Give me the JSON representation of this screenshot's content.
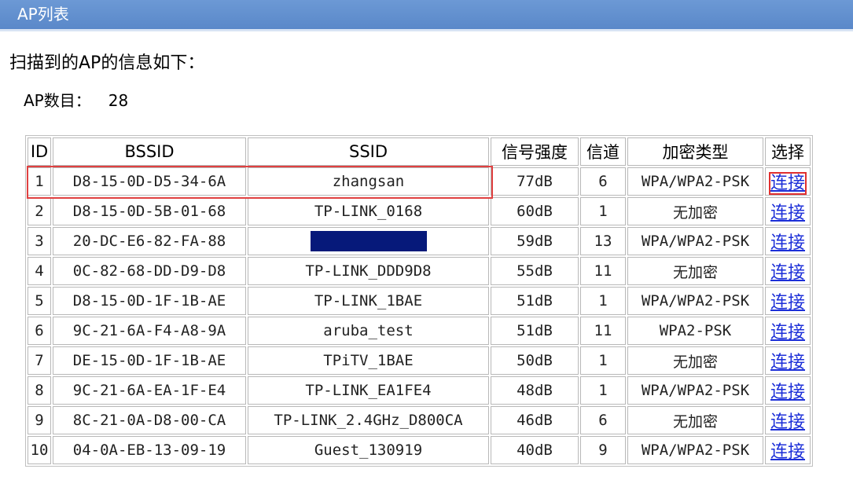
{
  "titlebar": {
    "title": "AP列表"
  },
  "heading": "扫描到的AP的信息如下：",
  "ap_count": {
    "label": "AP数目：",
    "value": "28"
  },
  "table": {
    "columns": [
      "ID",
      "BSSID",
      "SSID",
      "信号强度",
      "信道",
      "加密类型",
      "选择"
    ],
    "rows": [
      {
        "id": "1",
        "bssid": "D8-15-0D-D5-34-6A",
        "ssid": "zhangsan",
        "signal": "77dB",
        "channel": "6",
        "encryption": "WPA/WPA2-PSK",
        "action": "连接"
      },
      {
        "id": "2",
        "bssid": "D8-15-0D-5B-01-68",
        "ssid": "TP-LINK_0168",
        "signal": "60dB",
        "channel": "1",
        "encryption": "无加密",
        "action": "连接"
      },
      {
        "id": "3",
        "bssid": "20-DC-E6-82-FA-88",
        "ssid": "",
        "signal": "59dB",
        "channel": "13",
        "encryption": "WPA/WPA2-PSK",
        "action": "连接"
      },
      {
        "id": "4",
        "bssid": "0C-82-68-DD-D9-D8",
        "ssid": "TP-LINK_DDD9D8",
        "signal": "55dB",
        "channel": "11",
        "encryption": "无加密",
        "action": "连接"
      },
      {
        "id": "5",
        "bssid": "D8-15-0D-1F-1B-AE",
        "ssid": "TP-LINK_1BAE",
        "signal": "51dB",
        "channel": "1",
        "encryption": "WPA/WPA2-PSK",
        "action": "连接"
      },
      {
        "id": "6",
        "bssid": "9C-21-6A-F4-A8-9A",
        "ssid": "aruba_test",
        "signal": "51dB",
        "channel": "11",
        "encryption": "WPA2-PSK",
        "action": "连接"
      },
      {
        "id": "7",
        "bssid": "DE-15-0D-1F-1B-AE",
        "ssid": "TPiTV_1BAE",
        "signal": "50dB",
        "channel": "1",
        "encryption": "无加密",
        "action": "连接"
      },
      {
        "id": "8",
        "bssid": "9C-21-6A-EA-1F-E4",
        "ssid": "TP-LINK_EA1FE4",
        "signal": "48dB",
        "channel": "1",
        "encryption": "WPA/WPA2-PSK",
        "action": "连接"
      },
      {
        "id": "9",
        "bssid": "8C-21-0A-D8-00-CA",
        "ssid": "TP-LINK_2.4GHz_D800CA",
        "signal": "46dB",
        "channel": "6",
        "encryption": "无加密",
        "action": "连接"
      },
      {
        "id": "10",
        "bssid": "04-0A-EB-13-09-19",
        "ssid": "Guest_130919",
        "signal": "40dB",
        "channel": "9",
        "encryption": "WPA/WPA2-PSK",
        "action": "连接"
      }
    ]
  },
  "colors": {
    "titlebar": "#5a88c9",
    "link": "#1c2fd8",
    "highlight": "#e03030",
    "redaction": "#06197a"
  }
}
